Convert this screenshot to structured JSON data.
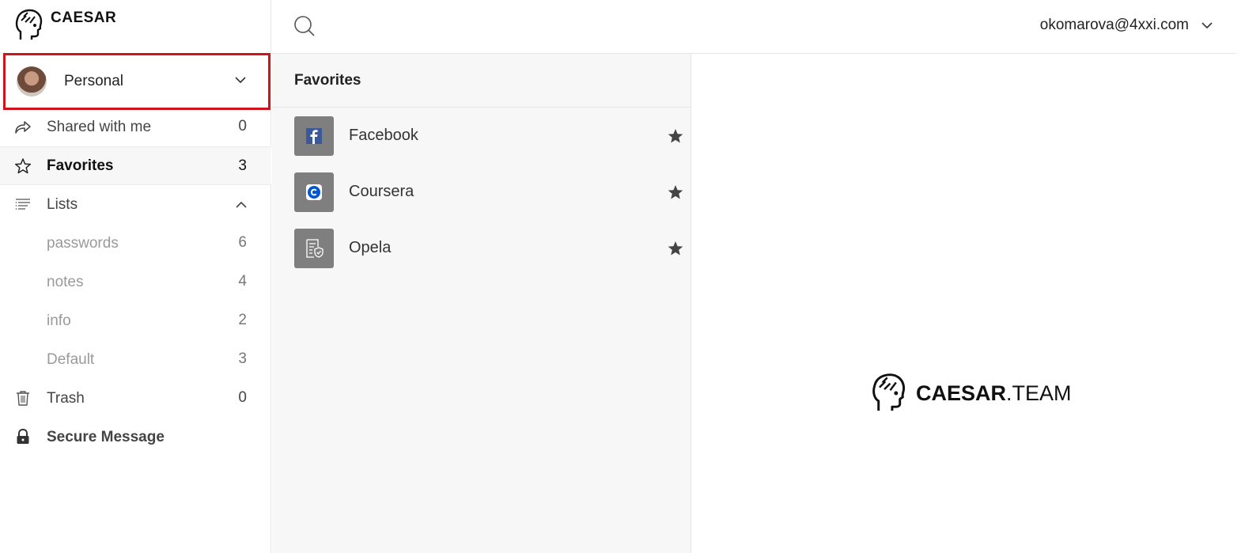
{
  "brand": {
    "name": "CAESAR"
  },
  "account": {
    "label": "Personal"
  },
  "nav": {
    "shared": {
      "label": "Shared with me",
      "count": "0"
    },
    "favorites": {
      "label": "Favorites",
      "count": "3"
    },
    "lists": {
      "label": "Lists"
    },
    "passwords": {
      "label": "passwords",
      "count": "6"
    },
    "notes": {
      "label": "notes",
      "count": "4"
    },
    "info": {
      "label": "info",
      "count": "2"
    },
    "default": {
      "label": "Default",
      "count": "3"
    },
    "trash": {
      "label": "Trash",
      "count": "0"
    },
    "secure": {
      "label": "Secure Message"
    }
  },
  "topbar": {
    "user_email": "okomarova@4xxi.com"
  },
  "list": {
    "title": "Favorites",
    "items": [
      {
        "label": "Facebook",
        "icon": "facebook-icon",
        "starred": true
      },
      {
        "label": "Coursera",
        "icon": "coursera-icon",
        "starred": true
      },
      {
        "label": "Opela",
        "icon": "document-shield-icon",
        "starred": true
      }
    ]
  },
  "detail": {
    "logo_bold": "CAESAR",
    "logo_light": ".TEAM"
  },
  "colors": {
    "highlight": "#d0141b",
    "icon_tile": "#7f7f7f",
    "facebook": "#3b5998",
    "coursera": "#0056d2"
  }
}
